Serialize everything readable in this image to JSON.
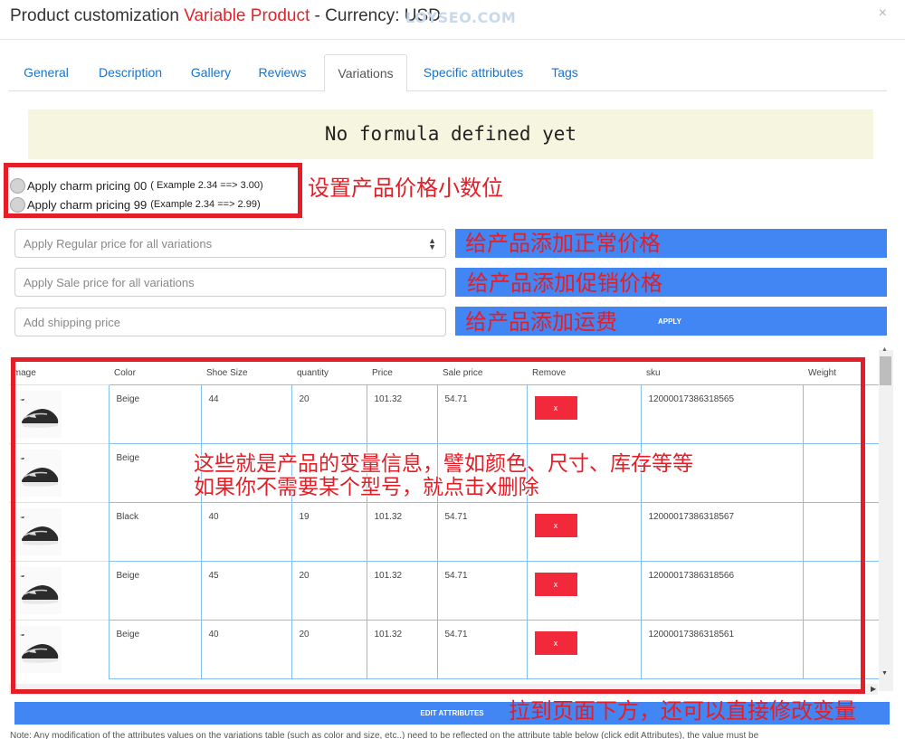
{
  "header": {
    "title_prefix": "Product customization ",
    "title_product": "Variable Product",
    "title_currency": " - Currency: USD",
    "watermark": "LOYSEO.COM",
    "close": "×"
  },
  "tabs": [
    "General",
    "Description",
    "Gallery",
    "Reviews",
    "Variations",
    "Specific attributes",
    "Tags"
  ],
  "active_tab": "Variations",
  "formula_text": "No formula defined yet",
  "charm": {
    "option_00_label": "Apply charm pricing 00",
    "option_00_example": "( Example 2.34 ==> 3.00)",
    "option_99_label": "Apply charm pricing 99",
    "option_99_example": "(Example 2.34 ==> 2.99)"
  },
  "inputs": {
    "regular_placeholder": "Apply Regular price for all variations",
    "sale_placeholder": "Apply Sale price for all variations",
    "shipping_placeholder": "Add shipping price"
  },
  "apply_label": "APPLY",
  "annotations": {
    "charm": "设置产品价格小数位",
    "regular": "给产品添加正常价格",
    "sale": "给产品添加促销价格",
    "shipping": "给产品添加运费",
    "table_line1": "这些就是产品的变量信息，譬如颜色、尺寸、库存等等",
    "table_line2": "如果你不需要某个型号，就点击x删除",
    "bottom": "拉到页面下方，还可以直接修改变量"
  },
  "table": {
    "headers": [
      "Image",
      "Color",
      "Shoe Size",
      "quantity",
      "Price",
      "Sale price",
      "Remove",
      "sku",
      "Weight"
    ],
    "remove_label": "x",
    "rows": [
      {
        "color": "Beige",
        "size": "44",
        "quantity": "20",
        "price": "101.32",
        "sale": "54.71",
        "sku": "12000017386318565"
      },
      {
        "color": "Beige",
        "size": "",
        "quantity": "",
        "price": "",
        "sale": "",
        "sku": ""
      },
      {
        "color": "Black",
        "size": "40",
        "quantity": "19",
        "price": "101.32",
        "sale": "54.71",
        "sku": "12000017386318567"
      },
      {
        "color": "Beige",
        "size": "45",
        "quantity": "20",
        "price": "101.32",
        "sale": "54.71",
        "sku": "12000017386318566"
      },
      {
        "color": "Beige",
        "size": "40",
        "quantity": "20",
        "price": "101.32",
        "sale": "54.71",
        "sku": "12000017386318561"
      }
    ]
  },
  "edit_attributes_label": "EDIT ATTRIBUTES",
  "note": "Note: Any modification of the attributes values on the variations table (such as color and size, etc..) need to be reflected on the attribute table below (click edit Attributes), the value must be",
  "colors": {
    "accent_blue": "#4286f4",
    "annotation_red": "#e41e26",
    "remove_red": "#f2283b",
    "link_blue": "#1a73c8"
  }
}
